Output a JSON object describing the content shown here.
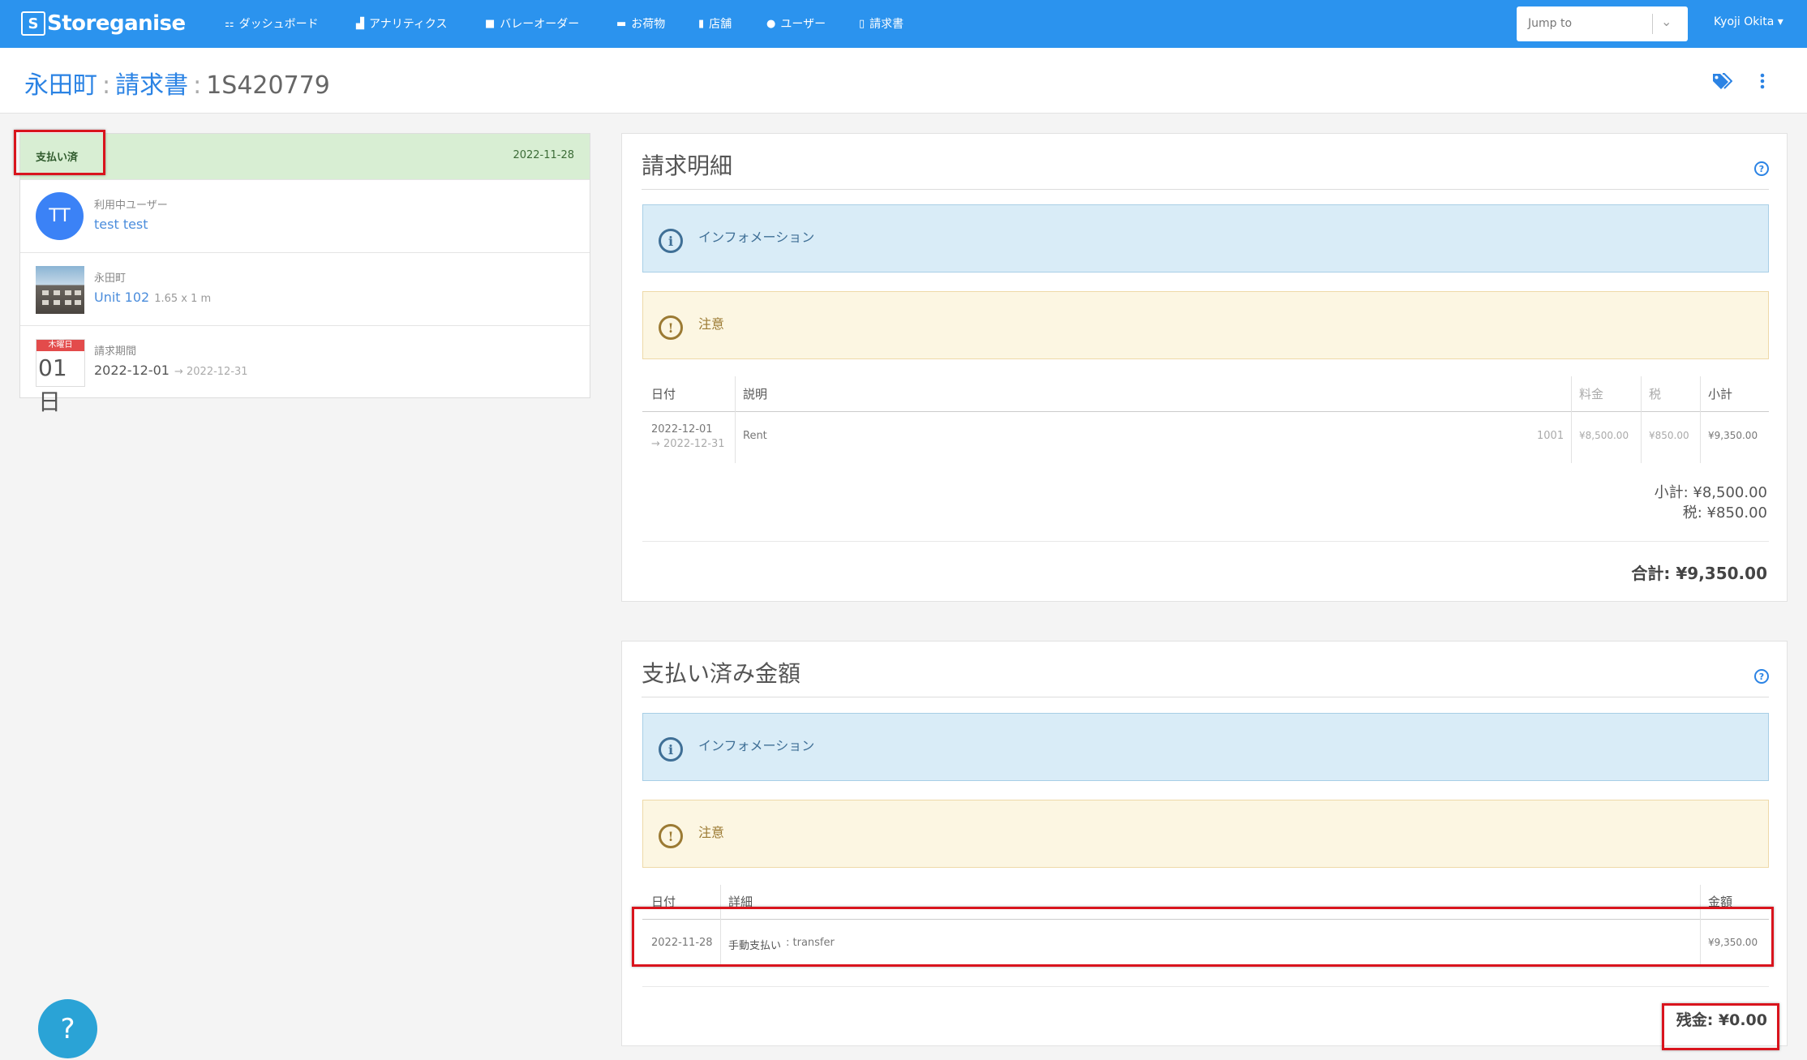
{
  "app": {
    "logo": "Storeganise"
  },
  "nav": {
    "items": [
      {
        "label": "ダッシュボード",
        "icon": "sitemap-icon"
      },
      {
        "label": "アナリティクス",
        "icon": "chart-icon"
      },
      {
        "label": "バレーオーダー",
        "icon": "truck-icon"
      },
      {
        "label": "お荷物",
        "icon": "archive-icon"
      },
      {
        "label": "店舗",
        "icon": "building-icon"
      },
      {
        "label": "ユーザー",
        "icon": "user-icon"
      },
      {
        "label": "請求書",
        "icon": "file-icon"
      }
    ],
    "jump_placeholder": "Jump to",
    "user_name": "Kyoji Okita"
  },
  "header": {
    "site": "永田町",
    "section": "請求書",
    "invoice_number": "1S420779"
  },
  "summary": {
    "status": "支払い済",
    "status_date": "2022-11-28",
    "user_label": "利用中ユーザー",
    "user_name": "test test",
    "user_initials": "TT",
    "site_label": "永田町",
    "unit_name": "Unit 102",
    "unit_size": "1.65 x 1 m",
    "period_label": "請求期間",
    "period_start": "2022-12-01",
    "period_end": "2022-12-31",
    "calendar_weekday": "木曜日",
    "calendar_day": "01",
    "calendar_unit": "日"
  },
  "charges": {
    "title": "請求明細",
    "info": "インフォメーション",
    "warning": "注意",
    "headers": {
      "date": "日付",
      "description": "説明",
      "amount": "料金",
      "tax": "税",
      "subtotal": "小計"
    },
    "rows": [
      {
        "date": "2022-12-01",
        "date_end": "2022-12-31",
        "description": "Rent",
        "code": "1001",
        "amount": "¥8,500.00",
        "tax": "¥850.00",
        "subtotal": "¥9,350.00"
      }
    ],
    "subtotal_line": "小計: ¥8,500.00",
    "tax_line": "税: ¥850.00",
    "total_line": "合計: ¥9,350.00"
  },
  "payments": {
    "title": "支払い済み金額",
    "info": "インフォメーション",
    "warning": "注意",
    "headers": {
      "date": "日付",
      "detail": "詳細",
      "amount": "金額"
    },
    "rows": [
      {
        "date": "2022-11-28",
        "method": "手動支払い",
        "note": ": transfer",
        "amount": "¥9,350.00"
      }
    ],
    "balance_line": "残金: ¥0.00"
  },
  "help_fab": "?",
  "colors": {
    "brand": "#2b93ee",
    "link": "#2b83e4",
    "paid_bg": "#d8eed3",
    "highlight": "#d9141d"
  }
}
